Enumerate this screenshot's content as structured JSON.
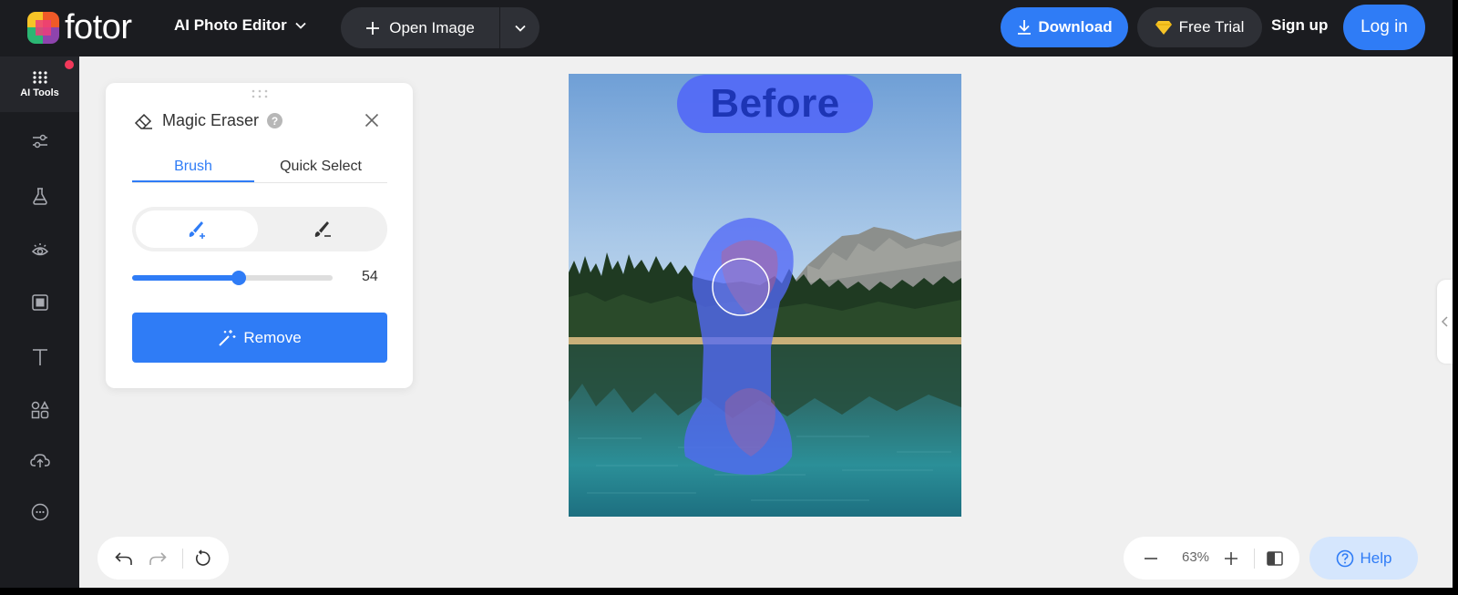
{
  "brand": {
    "name": "fotor"
  },
  "topbar": {
    "editor_menu": "AI Photo Editor",
    "open_image": "Open Image",
    "download": "Download",
    "free_trial": "Free Trial",
    "sign_up": "Sign up",
    "log_in": "Log in"
  },
  "sidebar": {
    "ai_tools": "AI Tools",
    "items": [
      "adjust",
      "beauty",
      "effects",
      "frames",
      "text",
      "elements",
      "upload",
      "more"
    ]
  },
  "panel": {
    "title": "Magic Eraser",
    "help": "?",
    "tabs": [
      "Brush",
      "Quick Select"
    ],
    "active_tab": "Brush",
    "brush_mode": "add",
    "brush_size": 54,
    "brush_size_fraction": 0.53,
    "remove_label": "Remove"
  },
  "canvas": {
    "badge": "Before"
  },
  "history": {
    "undo": "undo",
    "redo": "redo",
    "reset": "reset"
  },
  "zoom": {
    "value": "63%"
  },
  "help": {
    "label": "Help"
  },
  "colors": {
    "accent": "#2f7cf6",
    "topbar": "#1b1c20",
    "canvas_bg": "#f0f0f0",
    "mask": "#5369f6"
  }
}
